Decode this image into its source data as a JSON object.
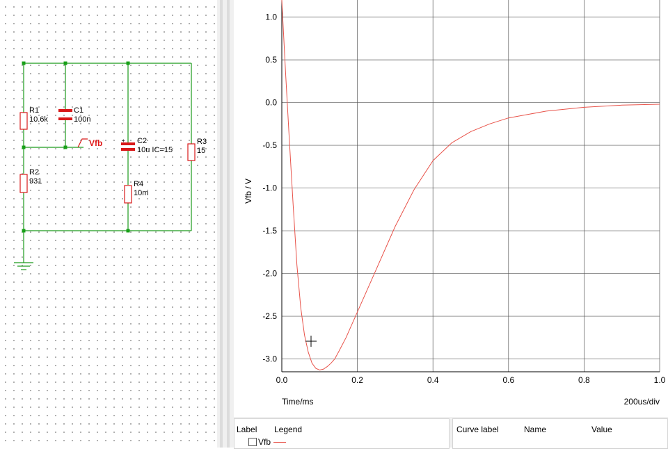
{
  "schematic": {
    "components": {
      "r1": {
        "name": "R1",
        "value": "10.6k"
      },
      "r2": {
        "name": "R2",
        "value": "931"
      },
      "r3": {
        "name": "R3",
        "value": "15"
      },
      "r4": {
        "name": "R4",
        "value": "10m"
      },
      "c1": {
        "name": "C1",
        "value": "100n"
      },
      "c2": {
        "name": "C2",
        "value": "10u IC=15"
      }
    },
    "probe_label": "Vfb",
    "plus_mark": "+",
    "colors": {
      "wire": "#1a9a1a",
      "part": "#d81818",
      "node": "#18a018"
    }
  },
  "plot": {
    "ylabel": "Vfb / V",
    "xlabel": "Time/ms",
    "div_label": "200us/div",
    "curve_color": "#e8534a"
  },
  "chart_data": {
    "type": "line",
    "xlabel": "Time/ms",
    "ylabel": "Vfb / V",
    "xlim": [
      0.0,
      1.0
    ],
    "ylim": [
      -3.15,
      1.2
    ],
    "xticks": [
      "0.0",
      "0.2",
      "0.4",
      "0.6",
      "0.8",
      "1.0"
    ],
    "yticks": [
      "1.0",
      "0.5",
      "0.0",
      "-0.5",
      "-1.0",
      "-1.5",
      "-2.0",
      "-2.5",
      "-3.0"
    ],
    "grid": true,
    "series": [
      {
        "name": "Vfb",
        "x": [
          0.0,
          0.01,
          0.02,
          0.03,
          0.04,
          0.05,
          0.06,
          0.07,
          0.08,
          0.09,
          0.1,
          0.11,
          0.12,
          0.13,
          0.14,
          0.15,
          0.17,
          0.2,
          0.25,
          0.3,
          0.35,
          0.4,
          0.45,
          0.5,
          0.55,
          0.6,
          0.7,
          0.8,
          0.9,
          1.0
        ],
        "y": [
          1.2,
          0.35,
          -0.45,
          -1.2,
          -1.9,
          -2.4,
          -2.72,
          -2.92,
          -3.05,
          -3.11,
          -3.13,
          -3.12,
          -3.09,
          -3.05,
          -3.0,
          -2.92,
          -2.75,
          -2.45,
          -1.95,
          -1.45,
          -1.02,
          -0.68,
          -0.47,
          -0.34,
          -0.25,
          -0.18,
          -0.1,
          -0.055,
          -0.03,
          -0.02
        ]
      }
    ]
  },
  "legend_panel": {
    "label_header": "Label",
    "legend_header": "Legend",
    "curve_name": "Vfb"
  },
  "values_panel": {
    "curve_label_header": "Curve label",
    "name_header": "Name",
    "value_header": "Value"
  }
}
